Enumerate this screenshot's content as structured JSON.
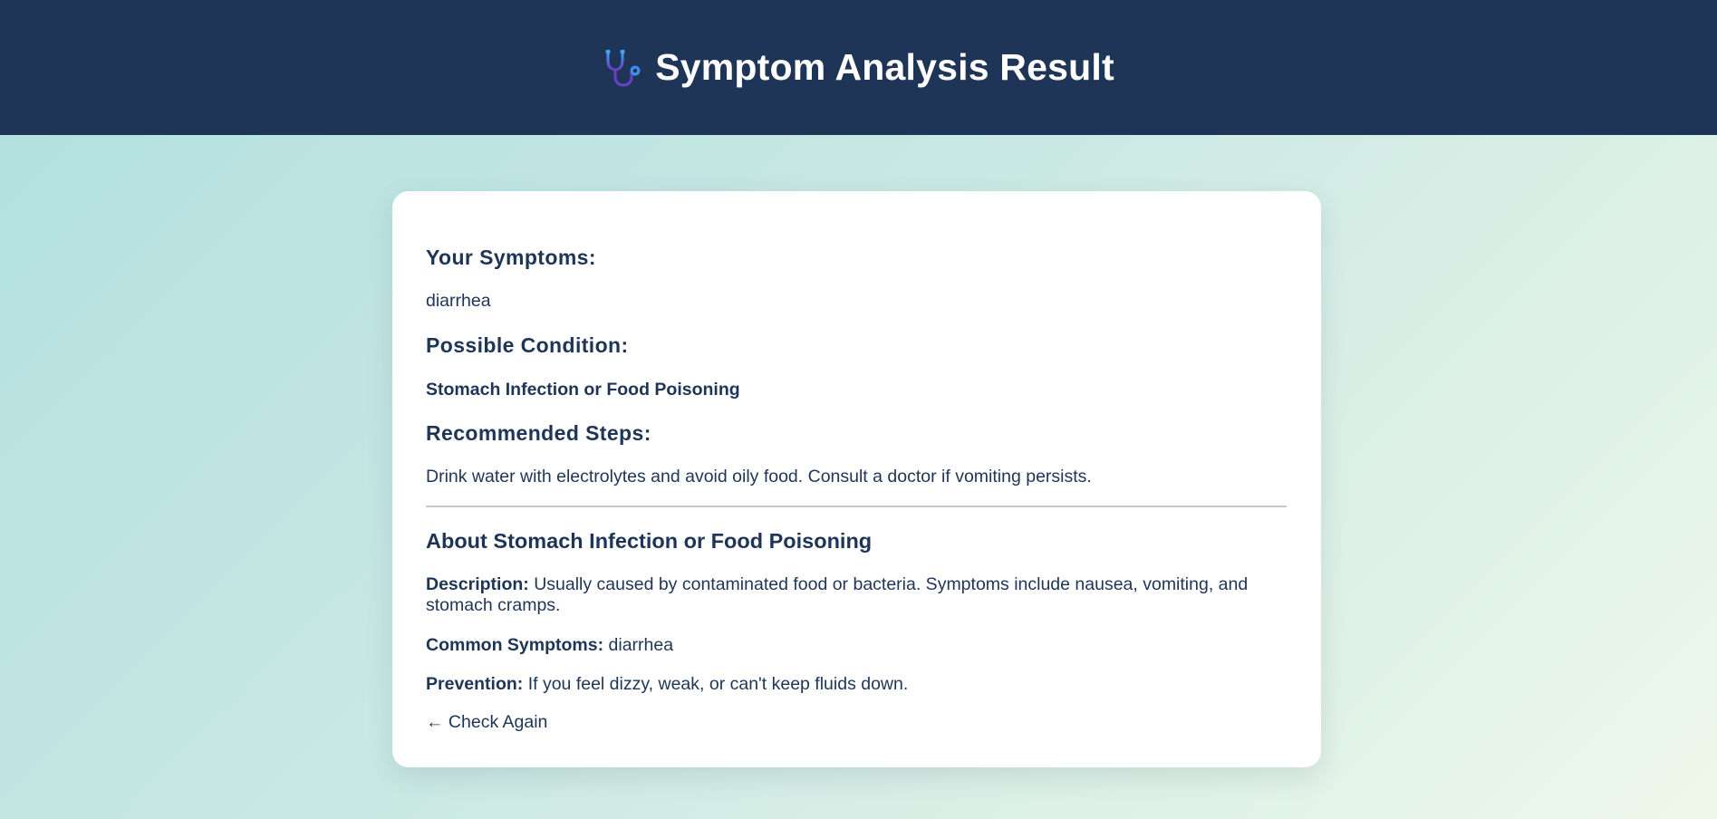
{
  "header": {
    "title": "Symptom Analysis Result",
    "icon": "stethoscope-icon"
  },
  "result": {
    "symptoms_heading": "Your Symptoms:",
    "symptoms_value": "diarrhea",
    "condition_heading": "Possible Condition:",
    "condition_value": "Stomach Infection or Food Poisoning",
    "steps_heading": "Recommended Steps:",
    "steps_value": "Drink water with electrolytes and avoid oily food. Consult a doctor if vomiting persists."
  },
  "about": {
    "heading": "About Stomach Infection or Food Poisoning",
    "description_label": "Description:",
    "description_value": "Usually caused by contaminated food or bacteria. Symptoms include nausea, vomiting, and stomach cramps.",
    "common_symptoms_label": "Common Symptoms:",
    "common_symptoms_value": "diarrhea",
    "prevention_label": "Prevention:",
    "prevention_value": "If you feel dizzy, weak, or can't keep fluids down."
  },
  "actions": {
    "check_again_label": "← Check Again"
  },
  "colors": {
    "header_bg": "#1f3557",
    "text": "#1e3557",
    "card_bg": "#ffffff",
    "divider": "#c3c8cc"
  }
}
